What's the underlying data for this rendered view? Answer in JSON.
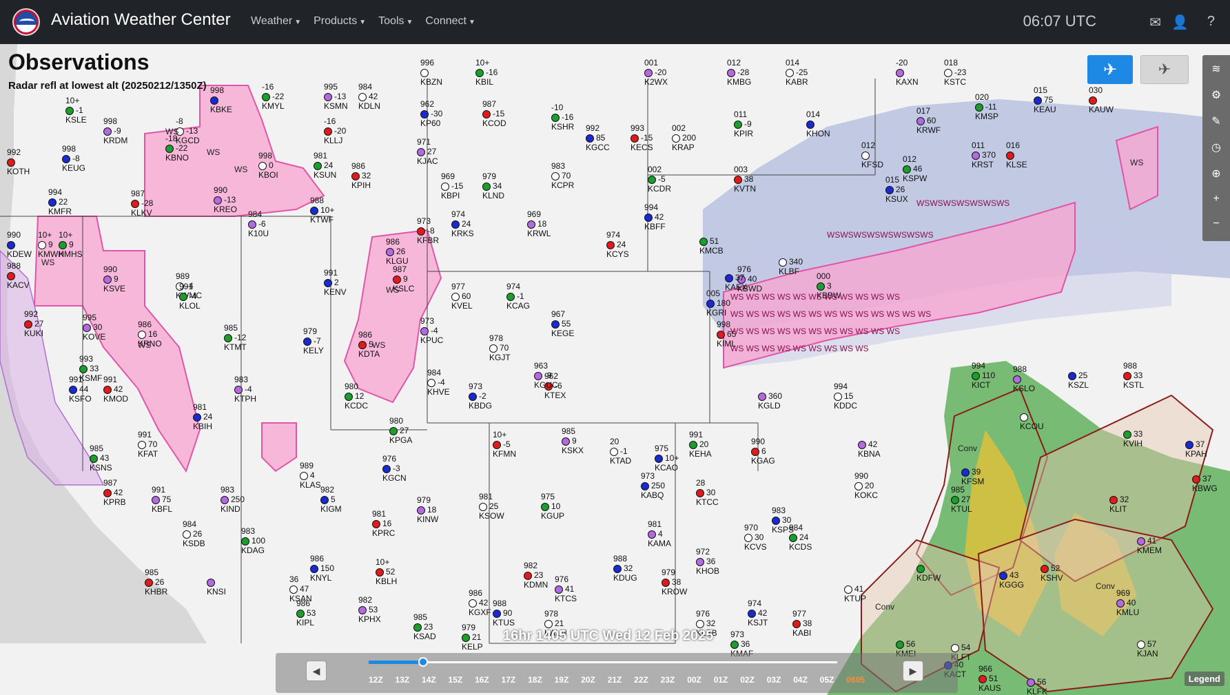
{
  "nav": {
    "brand": "Aviation Weather Center",
    "items": [
      {
        "label": "Weather"
      },
      {
        "label": "Products"
      },
      {
        "label": "Tools"
      },
      {
        "label": "Connect"
      }
    ],
    "time": "06:07 UTC",
    "icons": [
      "envelope-icon",
      "user-icon",
      "help-icon"
    ]
  },
  "panel": {
    "title": "Observations",
    "subtitle": "Radar refl at lowest alt (20250212/1350Z)"
  },
  "stations": [
    {
      "id": "KSLE",
      "temp": "10+",
      "dew": "-1"
    },
    {
      "id": "KEUG",
      "temp": "998",
      "dew": "-8"
    },
    {
      "id": "KOTH",
      "temp": "992",
      "dew": ""
    },
    {
      "id": "KRDM",
      "temp": "998",
      "dew": "-9"
    },
    {
      "id": "KGCD",
      "temp": "-8",
      "dew": "-13"
    },
    {
      "id": "KBNO",
      "temp": "-18",
      "dew": "-22"
    },
    {
      "id": "KMFR",
      "temp": "994",
      "dew": "22"
    },
    {
      "id": "KLKV",
      "temp": "987",
      "dew": "-28"
    },
    {
      "id": "KREO",
      "temp": "990",
      "dew": "-13"
    },
    {
      "id": "KBOI",
      "temp": "998",
      "dew": "0"
    },
    {
      "id": "KSUN",
      "temp": "981",
      "dew": "24"
    },
    {
      "id": "KTWF",
      "temp": "988",
      "dew": "10+"
    },
    {
      "id": "KLLJ",
      "temp": "-16",
      "dew": "-20"
    },
    {
      "id": "KSMN",
      "temp": "995",
      "dew": "-13"
    },
    {
      "id": "KDLN",
      "temp": "984",
      "dew": "42"
    },
    {
      "id": "KMYL",
      "temp": "-16",
      "dew": "-22"
    },
    {
      "id": "KBKE",
      "temp": "998",
      "dew": ""
    },
    {
      "id": "KPIH",
      "temp": "986",
      "dew": "32"
    },
    {
      "id": "K10U",
      "temp": "984",
      "dew": "-6"
    },
    {
      "id": "KBZN",
      "temp": "996",
      "dew": ""
    },
    {
      "id": "KBIL",
      "temp": "10+",
      "dew": "-16"
    },
    {
      "id": "KP60",
      "temp": "962",
      "dew": "-30"
    },
    {
      "id": "KCOD",
      "temp": "987",
      "dew": "-15"
    },
    {
      "id": "KJAC",
      "temp": "971",
      "dew": "27"
    },
    {
      "id": "KBPI",
      "temp": "969",
      "dew": "-15"
    },
    {
      "id": "KLND",
      "temp": "979",
      "dew": "34"
    },
    {
      "id": "KRKS",
      "temp": "974",
      "dew": "24"
    },
    {
      "id": "KFBR",
      "temp": "973",
      "dew": "-8"
    },
    {
      "id": "KRWL",
      "temp": "969",
      "dew": "18"
    },
    {
      "id": "KCPR",
      "temp": "983",
      "dew": "70"
    },
    {
      "id": "KSHR",
      "temp": "-10",
      "dew": "-16"
    },
    {
      "id": "KGCC",
      "temp": "992",
      "dew": "85"
    },
    {
      "id": "KECS",
      "temp": "993",
      "dew": "-15"
    },
    {
      "id": "K2WX",
      "temp": "001",
      "dew": "-20"
    },
    {
      "id": "KRAP",
      "temp": "002",
      "dew": "200"
    },
    {
      "id": "KCDR",
      "temp": "002",
      "dew": "-5"
    },
    {
      "id": "KBFF",
      "temp": "994",
      "dew": "42"
    },
    {
      "id": "KCYS",
      "temp": "974",
      "dew": "24"
    },
    {
      "id": "KMBG",
      "temp": "012",
      "dew": "-28"
    },
    {
      "id": "KABR",
      "temp": "014",
      "dew": "-25"
    },
    {
      "id": "KPIR",
      "temp": "011",
      "dew": "-9"
    },
    {
      "id": "KHON",
      "temp": "014",
      "dew": ""
    },
    {
      "id": "KVTN",
      "temp": "003",
      "dew": "38"
    },
    {
      "id": "KAXN",
      "temp": "-20",
      "dew": ""
    },
    {
      "id": "KSTC",
      "temp": "018",
      "dew": "-23"
    },
    {
      "id": "KMSP",
      "temp": "020",
      "dew": "-11"
    },
    {
      "id": "KEAU",
      "temp": "015",
      "dew": "75"
    },
    {
      "id": "KAUW",
      "temp": "030",
      "dew": ""
    },
    {
      "id": "KRWF",
      "temp": "017",
      "dew": "60"
    },
    {
      "id": "KFSD",
      "temp": "012",
      "dew": ""
    },
    {
      "id": "KSPW",
      "temp": "012",
      "dew": "46"
    },
    {
      "id": "KSUX",
      "temp": "015",
      "dew": "26"
    },
    {
      "id": "KLSE",
      "temp": "016",
      "dew": ""
    },
    {
      "id": "KRST",
      "temp": "011",
      "dew": "370"
    },
    {
      "id": "KMWH",
      "temp": "10+",
      "dew": "9"
    },
    {
      "id": "KMHS",
      "temp": "10+",
      "dew": "9"
    },
    {
      "id": "KDEW",
      "temp": "990",
      "dew": ""
    },
    {
      "id": "KACV",
      "temp": "988",
      "dew": ""
    },
    {
      "id": "KSVE",
      "temp": "990",
      "dew": "9"
    },
    {
      "id": "KWMC",
      "temp": "989",
      "dew": "-4"
    },
    {
      "id": "KLOL",
      "temp": "991",
      "dew": "-4"
    },
    {
      "id": "KENV",
      "temp": "991",
      "dew": "2"
    },
    {
      "id": "KSLC",
      "temp": "987",
      "dew": "9"
    },
    {
      "id": "KLGU",
      "temp": "986",
      "dew": "26"
    },
    {
      "id": "KVEL",
      "temp": "977",
      "dew": "60"
    },
    {
      "id": "KCAG",
      "temp": "974",
      "dew": "-1"
    },
    {
      "id": "KEGE",
      "temp": "967",
      "dew": "55"
    },
    {
      "id": "KUKI",
      "temp": "992",
      "dew": "27"
    },
    {
      "id": "KOVE",
      "temp": "995",
      "dew": "30"
    },
    {
      "id": "KRNO",
      "temp": "986",
      "dew": "16"
    },
    {
      "id": "KTMT",
      "temp": "985",
      "dew": "-12"
    },
    {
      "id": "KELY",
      "temp": "979",
      "dew": "-7"
    },
    {
      "id": "KDTA",
      "temp": "986",
      "dew": "5"
    },
    {
      "id": "KPUC",
      "temp": "973",
      "dew": "-4"
    },
    {
      "id": "KGJT",
      "temp": "978",
      "dew": "70"
    },
    {
      "id": "KSMF",
      "temp": "993",
      "dew": "33"
    },
    {
      "id": "KSFO",
      "temp": "991",
      "dew": "44"
    },
    {
      "id": "KMOD",
      "temp": "991",
      "dew": "42"
    },
    {
      "id": "KTPH",
      "temp": "983",
      "dew": "-4"
    },
    {
      "id": "KHVE",
      "temp": "984",
      "dew": "-4"
    },
    {
      "id": "KCDC",
      "temp": "980",
      "dew": "12"
    },
    {
      "id": "KBDG",
      "temp": "973",
      "dew": "-2"
    },
    {
      "id": "KTEX",
      "temp": "962",
      "dew": "-6"
    },
    {
      "id": "KGUC",
      "temp": "963",
      "dew": "-9"
    },
    {
      "id": "KFAT",
      "temp": "991",
      "dew": "70"
    },
    {
      "id": "KSNS",
      "temp": "985",
      "dew": "43"
    },
    {
      "id": "KBIH",
      "temp": "981",
      "dew": "24"
    },
    {
      "id": "KPRB",
      "temp": "987",
      "dew": "42"
    },
    {
      "id": "KBFL",
      "temp": "991",
      "dew": "75"
    },
    {
      "id": "KLAS",
      "temp": "989",
      "dew": "4"
    },
    {
      "id": "KPGA",
      "temp": "980",
      "dew": "27"
    },
    {
      "id": "KGCN",
      "temp": "976",
      "dew": "-3"
    },
    {
      "id": "KFMN",
      "temp": "10+",
      "dew": "-5"
    },
    {
      "id": "KSKX",
      "temp": "985",
      "dew": "9"
    },
    {
      "id": "KTAD",
      "temp": "20",
      "dew": "-1"
    },
    {
      "id": "KEHA",
      "temp": "991",
      "dew": "20"
    },
    {
      "id": "KCAO",
      "temp": "975",
      "dew": "10+"
    },
    {
      "id": "KGAG",
      "temp": "990",
      "dew": "6"
    },
    {
      "id": "KIND",
      "temp": "983",
      "dew": "250"
    },
    {
      "id": "KSDB",
      "temp": "984",
      "dew": "26"
    },
    {
      "id": "KDAG",
      "temp": "983",
      "dew": "100"
    },
    {
      "id": "KIGM",
      "temp": "982",
      "dew": "5"
    },
    {
      "id": "KPRC",
      "temp": "981",
      "dew": "16"
    },
    {
      "id": "KINW",
      "temp": "979",
      "dew": "18"
    },
    {
      "id": "KSOW",
      "temp": "981",
      "dew": "25"
    },
    {
      "id": "KGUP",
      "temp": "975",
      "dew": "10"
    },
    {
      "id": "KABQ",
      "temp": "973",
      "dew": "250"
    },
    {
      "id": "KTCC",
      "temp": "28",
      "dew": "30"
    },
    {
      "id": "KAMA",
      "temp": "981",
      "dew": "4"
    },
    {
      "id": "KCVS",
      "temp": "970",
      "dew": "30"
    },
    {
      "id": "KCDS",
      "temp": "984",
      "dew": "24"
    },
    {
      "id": "KSPS",
      "temp": "983",
      "dew": "30"
    },
    {
      "id": "KHBR",
      "temp": "985",
      "dew": "26"
    },
    {
      "id": "KNSI",
      "temp": "",
      "dew": ""
    },
    {
      "id": "KSAN",
      "temp": "36",
      "dew": "47"
    },
    {
      "id": "KIPL",
      "temp": "986",
      "dew": "53"
    },
    {
      "id": "KNYL",
      "temp": "986",
      "dew": "150"
    },
    {
      "id": "KBLH",
      "temp": "10+",
      "dew": "52"
    },
    {
      "id": "KPHX",
      "temp": "982",
      "dew": "53"
    },
    {
      "id": "KGXF",
      "temp": "986",
      "dew": "42"
    },
    {
      "id": "KSAD",
      "temp": "985",
      "dew": "23"
    },
    {
      "id": "KTUS",
      "temp": "988",
      "dew": "90"
    },
    {
      "id": "KDMN",
      "temp": "982",
      "dew": "23"
    },
    {
      "id": "KTCS",
      "temp": "976",
      "dew": "41"
    },
    {
      "id": "KALM",
      "temp": "978",
      "dew": "21"
    },
    {
      "id": "KELP",
      "temp": "979",
      "dew": "21"
    },
    {
      "id": "KDUG",
      "temp": "988",
      "dew": "32"
    },
    {
      "id": "KROW",
      "temp": "979",
      "dew": "38"
    },
    {
      "id": "KHOB",
      "temp": "972",
      "dew": "36"
    },
    {
      "id": "KLBB",
      "temp": "976",
      "dew": "32"
    },
    {
      "id": "KMAF",
      "temp": "973",
      "dew": "36"
    },
    {
      "id": "KSJT",
      "temp": "974",
      "dew": "42"
    },
    {
      "id": "KABI",
      "temp": "977",
      "dew": "38"
    },
    {
      "id": "KBWD",
      "temp": "976",
      "dew": "40"
    },
    {
      "id": "KLBF",
      "temp": "",
      "dew": "340"
    },
    {
      "id": "KBBW",
      "temp": "000",
      "dew": "3"
    },
    {
      "id": "KGRI",
      "temp": "005",
      "dew": "180"
    },
    {
      "id": "KIML",
      "temp": "998",
      "dew": "65"
    },
    {
      "id": "KGLD",
      "temp": "",
      "dew": "360"
    },
    {
      "id": "KDDC",
      "temp": "994",
      "dew": "15"
    },
    {
      "id": "KICT",
      "temp": "994",
      "dew": "110"
    },
    {
      "id": "KSZL",
      "temp": "",
      "dew": "25"
    },
    {
      "id": "KSTL",
      "temp": "988",
      "dew": "33"
    },
    {
      "id": "KSLO",
      "temp": "988",
      "dew": ""
    },
    {
      "id": "KCOU",
      "temp": "",
      "dew": ""
    },
    {
      "id": "KVIH",
      "temp": "",
      "dew": "33"
    },
    {
      "id": "KPAH",
      "temp": "",
      "dew": "37"
    },
    {
      "id": "KBWG",
      "temp": "",
      "dew": "37"
    },
    {
      "id": "KBNA",
      "temp": "",
      "dew": "42"
    },
    {
      "id": "KOKC",
      "temp": "990",
      "dew": "20"
    },
    {
      "id": "KTUL",
      "temp": "985",
      "dew": "27"
    },
    {
      "id": "KFSM",
      "temp": "",
      "dew": "39"
    },
    {
      "id": "KLIT",
      "temp": "",
      "dew": "32"
    },
    {
      "id": "KMEM",
      "temp": "",
      "dew": "41"
    },
    {
      "id": "KTUP",
      "temp": "",
      "dew": "41"
    },
    {
      "id": "KDFW",
      "temp": "",
      "dew": ""
    },
    {
      "id": "KGGG",
      "temp": "",
      "dew": "43"
    },
    {
      "id": "KSHV",
      "temp": "",
      "dew": "52"
    },
    {
      "id": "KMLU",
      "temp": "969",
      "dew": "40"
    },
    {
      "id": "KJAN",
      "temp": "",
      "dew": "57"
    },
    {
      "id": "KMEI",
      "temp": "",
      "dew": "56"
    },
    {
      "id": "KACT",
      "temp": "",
      "dew": "40"
    },
    {
      "id": "KAUS",
      "temp": "966",
      "dew": "51"
    },
    {
      "id": "KLFK",
      "temp": "",
      "dew": "56"
    },
    {
      "id": "KLFT",
      "temp": "",
      "dew": "54"
    },
    {
      "id": "KMCB",
      "temp": "",
      "dew": "51"
    },
    {
      "id": "KAEX",
      "temp": "",
      "dew": "37"
    }
  ],
  "overlays": {
    "ws_label": "WS",
    "conv_label": "Conv",
    "ws_texts": [
      "WSWSWSWSWSWSWS",
      "WSWSWSWSWSWSWSWS",
      "WS WS WS WS WS WS WS WS WS WS WS",
      "WS WS WS WS WS WS WS WS WS WS WS WS WS",
      "WS WS WS WS WS WS WS WS WS WS WS",
      "WS WS WS WS WS WS WS WS WS"
    ]
  },
  "timeline": {
    "title": "16hr 1405 UTC Wed 12 Feb 2025",
    "ticks": [
      "12Z",
      "13Z",
      "14Z",
      "15Z",
      "16Z",
      "17Z",
      "18Z",
      "19Z",
      "20Z",
      "21Z",
      "22Z",
      "23Z",
      "00Z",
      "01Z",
      "02Z",
      "03Z",
      "04Z",
      "05Z",
      "0605"
    ]
  },
  "legend_label": "Legend",
  "colors": {
    "navbar": "#202327",
    "accent": "#1e88e5",
    "sigmet_fill": "#f7a8d2",
    "sigmet_stroke": "#e055a8",
    "conv_stroke": "#8a1c1c",
    "conv_fill": "#e6c8b0",
    "radar_green": "#3fa33a",
    "radar_yellow": "#f0c030",
    "radar_blue": "#98a8d8"
  }
}
